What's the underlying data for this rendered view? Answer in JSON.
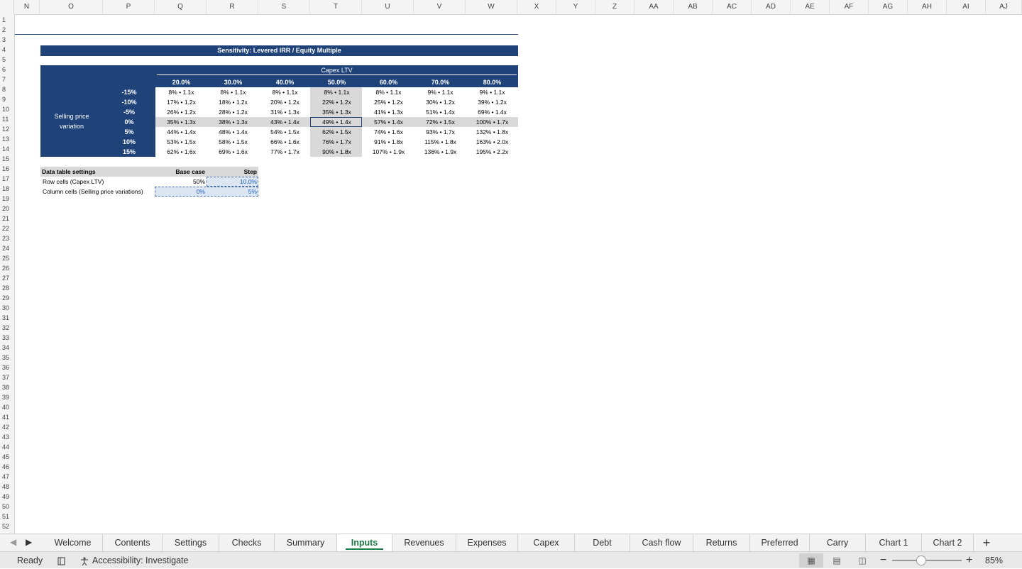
{
  "column_headers": [
    "N",
    "O",
    "P",
    "Q",
    "R",
    "S",
    "T",
    "U",
    "V",
    "W",
    "X",
    "Y",
    "Z",
    "AA",
    "AB",
    "AC",
    "AD",
    "AE",
    "AF",
    "AG",
    "AH",
    "AI",
    "AJ"
  ],
  "row_count": 52,
  "sensitivity": {
    "title": "Sensitivity: Levered IRR / Equity Multiple",
    "col_axis_label": "Capex LTV",
    "row_axis_label_line1": "Selling price",
    "row_axis_label_line2": "variation",
    "col_headers": [
      "20.0%",
      "30.0%",
      "40.0%",
      "50.0%",
      "60.0%",
      "70.0%",
      "80.0%"
    ],
    "row_headers": [
      "-15%",
      "-10%",
      "-5%",
      "0%",
      "5%",
      "10%",
      "15%"
    ],
    "values": [
      [
        "8% • 1.1x",
        "8% • 1.1x",
        "8% • 1.1x",
        "8% • 1.1x",
        "8% • 1.1x",
        "9% • 1.1x",
        "9% • 1.1x"
      ],
      [
        "17% • 1.2x",
        "18% • 1.2x",
        "20% • 1.2x",
        "22% • 1.2x",
        "25% • 1.2x",
        "30% • 1.2x",
        "39% • 1.2x"
      ],
      [
        "26% • 1.2x",
        "28% • 1.2x",
        "31% • 1.3x",
        "35% • 1.3x",
        "41% • 1.3x",
        "51% • 1.4x",
        "69% • 1.4x"
      ],
      [
        "35% • 1.3x",
        "38% • 1.3x",
        "43% • 1.4x",
        "49% • 1.4x",
        "57% • 1.4x",
        "72% • 1.5x",
        "100% • 1.7x"
      ],
      [
        "44% • 1.4x",
        "48% • 1.4x",
        "54% • 1.5x",
        "62% • 1.5x",
        "74% • 1.6x",
        "93% • 1.7x",
        "132% • 1.8x"
      ],
      [
        "53% • 1.5x",
        "58% • 1.5x",
        "66% • 1.6x",
        "76% • 1.7x",
        "91% • 1.8x",
        "115% • 1.8x",
        "163% • 2.0x"
      ],
      [
        "62% • 1.6x",
        "69% • 1.6x",
        "77% • 1.7x",
        "90% • 1.8x",
        "107% • 1.9x",
        "136% • 1.9x",
        "195% • 2.2x"
      ]
    ]
  },
  "settings": {
    "header": "Data table settings",
    "base_case_header": "Base case",
    "step_header": "Step",
    "row1_label": "Row cells (Capex LTV)",
    "row1_base": "50%",
    "row1_step": "10.0%",
    "row2_label": "Column cells (Selling price variations)",
    "row2_base": "0%",
    "row2_step": "5%"
  },
  "tabs": [
    "Welcome",
    "Contents",
    "Settings",
    "Checks",
    "Summary",
    "Inputs",
    "Revenues",
    "Expenses",
    "Capex",
    "Debt",
    "Cash flow",
    "Returns",
    "Preferred",
    "Carry",
    "Chart 1",
    "Chart 2"
  ],
  "active_tab": "Inputs",
  "add_sheet_label": "+",
  "status": {
    "ready": "Ready",
    "accessibility": "Accessibility: Investigate",
    "zoom": "85%"
  },
  "colors": {
    "header_navy": "#1f4279",
    "highlight_gray": "#d9d9d9",
    "active_tab_green": "#1e7a45",
    "input_blue": "#1f5fbf"
  }
}
